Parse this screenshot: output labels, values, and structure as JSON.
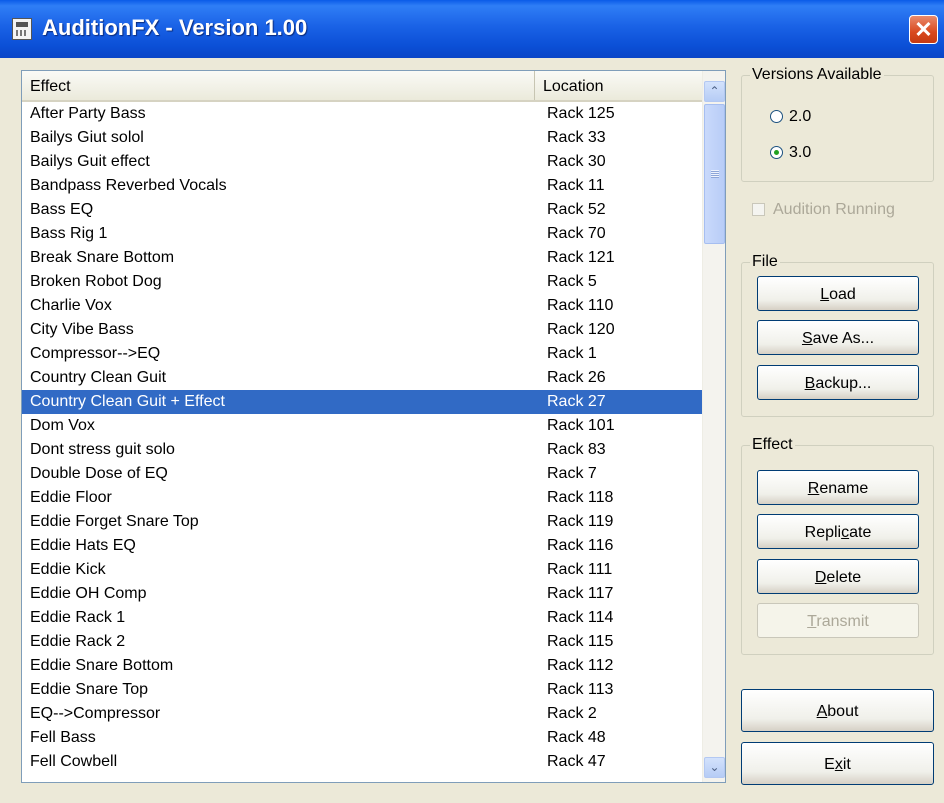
{
  "window": {
    "title": "AuditionFX - Version 1.00",
    "close_glyph": "✕"
  },
  "effects_list": {
    "columns": [
      "Effect",
      "Location"
    ],
    "selected_index": 12,
    "rows": [
      [
        "After Party Bass",
        "Rack 125"
      ],
      [
        "Bailys Giut solol",
        "Rack 33"
      ],
      [
        "Bailys Guit effect",
        "Rack 30"
      ],
      [
        "Bandpass Reverbed Vocals",
        "Rack 11"
      ],
      [
        "Bass EQ",
        "Rack 52"
      ],
      [
        "Bass Rig 1",
        "Rack 70"
      ],
      [
        "Break Snare Bottom",
        "Rack 121"
      ],
      [
        "Broken Robot Dog",
        "Rack 5"
      ],
      [
        "Charlie Vox",
        "Rack 110"
      ],
      [
        "City Vibe Bass",
        "Rack 120"
      ],
      [
        "Compressor-->EQ",
        "Rack 1"
      ],
      [
        "Country Clean Guit",
        "Rack 26"
      ],
      [
        "Country Clean Guit + Effect",
        "Rack 27"
      ],
      [
        "Dom Vox",
        "Rack 101"
      ],
      [
        "Dont stress guit solo",
        "Rack 83"
      ],
      [
        "Double Dose of EQ",
        "Rack 7"
      ],
      [
        "Eddie Floor",
        "Rack 118"
      ],
      [
        "Eddie Forget Snare Top",
        "Rack 119"
      ],
      [
        "Eddie Hats EQ",
        "Rack 116"
      ],
      [
        "Eddie Kick",
        "Rack 111"
      ],
      [
        "Eddie OH Comp",
        "Rack 117"
      ],
      [
        "Eddie Rack 1",
        "Rack 114"
      ],
      [
        "Eddie Rack 2",
        "Rack 115"
      ],
      [
        "Eddie Snare Bottom",
        "Rack 112"
      ],
      [
        "Eddie Snare Top",
        "Rack 113"
      ],
      [
        "EQ-->Compressor",
        "Rack 2"
      ],
      [
        "Fell Bass",
        "Rack 48"
      ],
      [
        "Fell Cowbell",
        "Rack 47"
      ]
    ]
  },
  "scrollbar": {
    "up_glyph": "⌃",
    "down_glyph": "⌄"
  },
  "versions": {
    "legend": "Versions Available",
    "options": [
      "2.0",
      "3.0"
    ],
    "selected": "3.0"
  },
  "audition_running": {
    "label": "Audition Running",
    "checked": false,
    "enabled": false
  },
  "file_group": {
    "legend": "File",
    "load": "Load",
    "save_as": "Save As...",
    "backup": "Backup..."
  },
  "effect_group": {
    "legend": "Effect",
    "rename": "Rename",
    "replicate": "Replicate",
    "delete": "Delete",
    "transmit": "Transmit",
    "transmit_enabled": false
  },
  "bottom_buttons": {
    "about": "About",
    "exit": "Exit"
  }
}
